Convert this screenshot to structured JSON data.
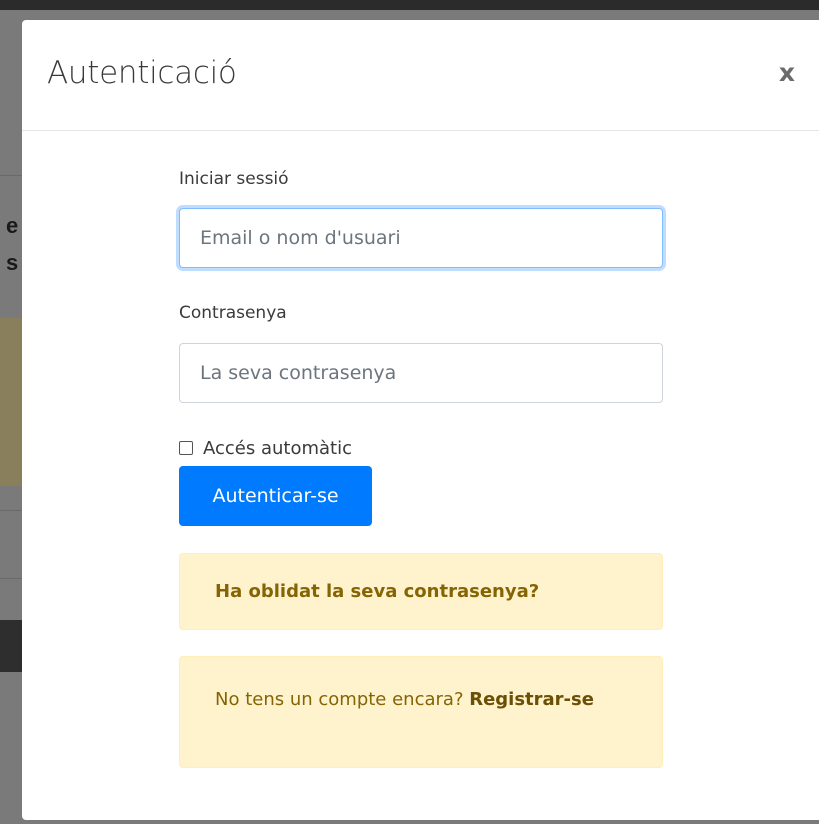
{
  "modal": {
    "title": "Autenticació",
    "close_label": "x"
  },
  "login": {
    "username_label": "Iniciar sessió",
    "username_placeholder": "Email o nom d'usuari",
    "password_label": "Contrasenya",
    "password_placeholder": "La seva contrasenya",
    "remember_label": "Accés automàtic",
    "remember_checked": false,
    "submit_label": "Autenticar-se"
  },
  "forgot": {
    "link_text": "Ha oblidat la seva contrasenya?"
  },
  "register": {
    "prompt_text": "No tens un compte encara? ",
    "link_text": "Registrar-se"
  },
  "colors": {
    "primary": "#007bff",
    "alert_bg": "#fff3cd",
    "alert_text": "#856404"
  }
}
